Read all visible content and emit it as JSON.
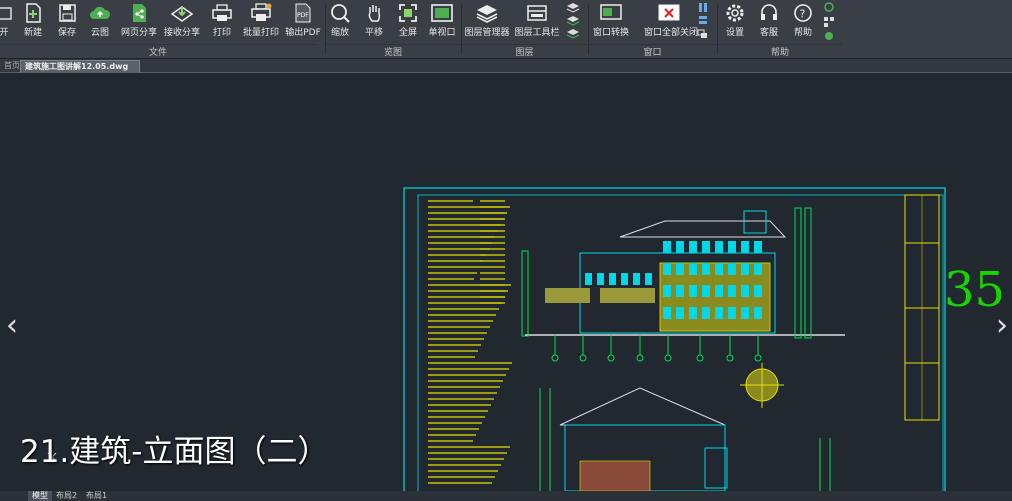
{
  "toolbar": {
    "tools": [
      {
        "label": "开",
        "icon": "open-icon"
      },
      {
        "label": "新建",
        "icon": "new-file-icon"
      },
      {
        "label": "保存",
        "icon": "save-icon"
      },
      {
        "label": "云图",
        "icon": "cloud-icon"
      },
      {
        "label": "网页分享",
        "icon": "share-icon"
      },
      {
        "label": "接收分享",
        "icon": "receive-icon"
      },
      {
        "label": "打印",
        "icon": "print-icon"
      },
      {
        "label": "批量打印",
        "icon": "batch-print-icon"
      },
      {
        "label": "输出PDF",
        "icon": "pdf-icon"
      },
      {
        "label": "缩放",
        "icon": "zoom-icon"
      },
      {
        "label": "平移",
        "icon": "pan-icon"
      },
      {
        "label": "全屏",
        "icon": "fullscreen-icon"
      },
      {
        "label": "单视口",
        "icon": "viewport-icon"
      },
      {
        "label": "图层管理器",
        "icon": "layer-manager-icon"
      },
      {
        "label": "图层工具栏",
        "icon": "layer-toolbar-icon"
      },
      {
        "label": "窗口转换",
        "icon": "window-switch-icon"
      },
      {
        "label": "窗口全部关闭",
        "icon": "close-all-icon"
      },
      {
        "label": "设置",
        "icon": "settings-icon"
      },
      {
        "label": "客服",
        "icon": "support-icon"
      },
      {
        "label": "帮助",
        "icon": "help-icon"
      }
    ],
    "groups": [
      "文件",
      "览图",
      "图层",
      "窗口",
      "帮助"
    ]
  },
  "tabs": {
    "home": "首页",
    "file": "建筑施工图讲解12.05.dwg"
  },
  "layout_tabs": [
    "模型",
    "布局2",
    "布局1"
  ],
  "slide": {
    "title": "21.建筑-立面图（二）",
    "page_number": "35"
  },
  "colors": {
    "ribbon": "#3a3f46",
    "canvas": "#212830",
    "drawing_cyan": "#00d8e8",
    "drawing_yellow": "#e8e000",
    "page_number": "#19d400"
  }
}
